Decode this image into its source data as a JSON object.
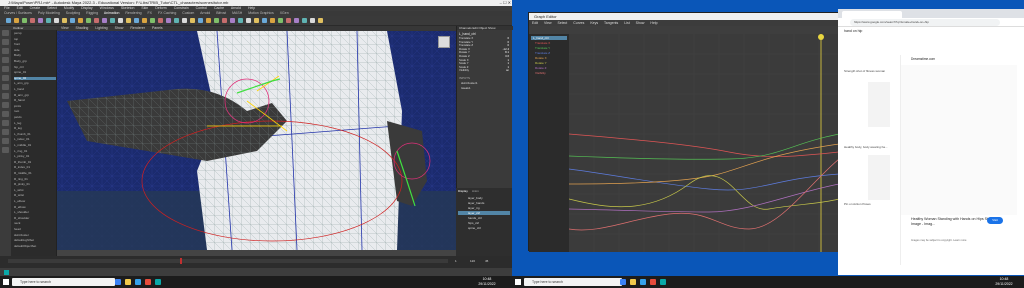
{
  "maya": {
    "title": "J:\\Maya\\Poser\\PRJ.mb* - Autodesk Maya 2022.3 - Educational Version: F:\\Libs\\TRIB_Tutor\\CTL_characters\\scenes\\tutor.mb",
    "menus": [
      "File",
      "Edit",
      "Create",
      "Select",
      "Modify",
      "Display",
      "Windows",
      "Skeleton",
      "Skin",
      "Deform",
      "Constrain",
      "Control",
      "Cache",
      "Arnold",
      "Help"
    ],
    "shelf_tabs": [
      "Curves / Surfaces",
      "Poly Modeling",
      "Sculpting",
      "Rigging",
      "Animation",
      "Rendering",
      "FX",
      "FX Caching",
      "Custom",
      "Arnold",
      "Bifrost",
      "MASH",
      "Motion Graphics",
      "XGen"
    ],
    "viewport_menu": [
      "View",
      "Shading",
      "Lighting",
      "Show",
      "Renderer",
      "Panels"
    ],
    "outliner_items": [
      "persp",
      "top",
      "front",
      "side",
      "Body",
      "Body_grp",
      "hip_ctrl",
      "spine_01",
      "spine_02",
      "L_arm_grp",
      "L_hand",
      "R_arm_grp",
      "R_hand",
      "joints",
      "root",
      "pelvis",
      "L_leg",
      "R_leg",
      "L_thumb_01",
      "L_index_01",
      "L_middle_01",
      "L_ring_01",
      "L_pinky_01",
      "R_thumb_01",
      "R_index_01",
      "R_middle_01",
      "R_ring_01",
      "R_pinky_01",
      "L_wrist",
      "R_wrist",
      "L_elbow",
      "R_elbow",
      "L_shoulder",
      "R_shoulder",
      "neck",
      "head",
      "skinCluster",
      "defaultLightSet",
      "defaultObjectSet"
    ],
    "selected_outliner_index": 8,
    "channel_box": {
      "header": "Channels  Edit  Object  Show",
      "node": "L_hand_ctrl",
      "attrs": [
        [
          "Translate X",
          "0"
        ],
        [
          "Translate Y",
          "0"
        ],
        [
          "Translate Z",
          "0"
        ],
        [
          "Rotate X",
          "-12.4"
        ],
        [
          "Rotate Y",
          "8.1"
        ],
        [
          "Rotate Z",
          "3.6"
        ],
        [
          "Scale X",
          "1"
        ],
        [
          "Scale Y",
          "1"
        ],
        [
          "Scale Z",
          "1"
        ],
        [
          "Visibility",
          "on"
        ]
      ],
      "inputs_label": "INPUTS",
      "inputs": [
        "skinCluster1",
        "tweak1"
      ]
    },
    "layers": {
      "tabs": [
        "Display",
        "Anim"
      ],
      "items": [
        "layer_body",
        "layer_hands",
        "layer_rig",
        "layer_ctrl",
        "hands_ctrl",
        "hips_ctrl",
        "spine_ctrl"
      ]
    },
    "timeline": {
      "start": "1",
      "end": "120",
      "current": "45"
    }
  },
  "graph_editor": {
    "title": "Graph Editor",
    "menus": [
      "Edit",
      "View",
      "Select",
      "Curves",
      "Keys",
      "Tangents",
      "List",
      "Show",
      "Help"
    ],
    "outliner_header": "L_hand_ctrl",
    "channels": [
      "Translate X",
      "Translate Y",
      "Translate Z",
      "Rotate X",
      "Rotate Y",
      "Rotate Z",
      "Visibility"
    ],
    "curve_colors": [
      "#e05555",
      "#55c055",
      "#5e7de0",
      "#e0a050",
      "#c8c84a",
      "#b070c0",
      "#e07070"
    ]
  },
  "browser": {
    "address": "https://www.google.com/search?q=female+hand+on+hip",
    "query": "hand on hip",
    "result_title": "Healthy Woman Standing with Hands on Hips Stock Image - Imag...",
    "result_source": "Dreamstime.com",
    "result_desc": "Images may be subject to copyright. Learn more",
    "visit_label": "Visit",
    "thumb_captions": [
      "Strength shot of fitness woman",
      "Hands on hips",
      "Healthy body, body wearing ha...",
      "Pin on Action Poses"
    ]
  },
  "taskbar_left": {
    "search_placeholder": "Type here to search",
    "time": "10:48",
    "date": "29/11/2022"
  },
  "taskbar_right": {
    "search_placeholder": "Type here to search",
    "time": "10:48",
    "date": "29/11/2022"
  }
}
